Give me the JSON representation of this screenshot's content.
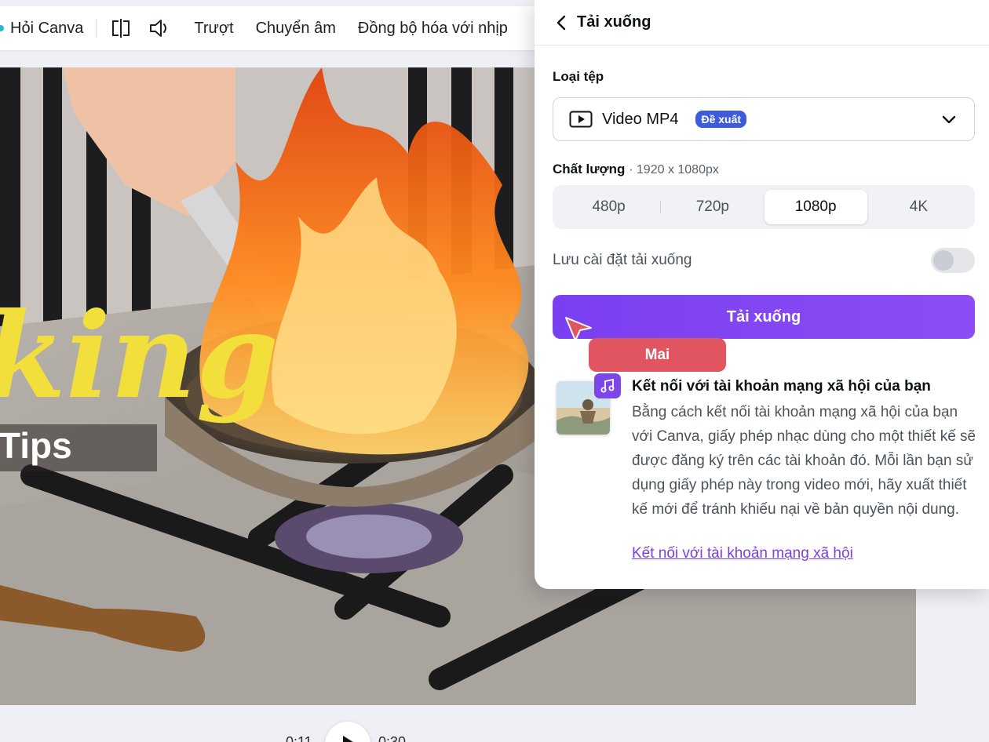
{
  "toolbar": {
    "ask_canva": "Hỏi Canva",
    "icons": [
      "flip-icon",
      "volume-icon"
    ],
    "transition": "Trượt",
    "transcribe": "Chuyển âm",
    "sync_beat": "Đồng bộ hóa với nhịp"
  },
  "canvas": {
    "overlay_word": "king",
    "overlay_tips": "Tips"
  },
  "playback": {
    "current_time": "0:11",
    "total_time": "0:30"
  },
  "panel": {
    "title": "Tải xuống",
    "file_type_label": "Loại tệp",
    "file_type_value": "Video MP4",
    "recommended_badge": "Đề xuất",
    "quality_label": "Chất lượng",
    "quality_resolution": "· 1920 x 1080px",
    "quality_options": [
      "480p",
      "720p",
      "1080p",
      "4K"
    ],
    "quality_selected": "1080p",
    "save_settings_label": "Lưu cài đặt tải xuống",
    "save_settings_on": false,
    "download_button": "Tải xuống",
    "connect": {
      "title": "Kết nối với tài khoản mạng xã hội của bạn",
      "body": "Bằng cách kết nối tài khoản mạng xã hội của bạn với Canva, giấy phép nhạc dùng cho một thiết kế sẽ được đăng ký trên các tài khoản đó. Mỗi lần bạn sử dụng giấy phép này trong video mới, hãy xuất thiết kế mới để tránh khiếu nại về bản quyền nội dung.",
      "link": "Kết nối với tài khoản mạng xã hội"
    }
  },
  "collaborator": {
    "name": "Mai",
    "color": "#e15561"
  },
  "colors": {
    "accent": "#7a3ff0",
    "badge": "#3f5bdd",
    "link": "#7c3fe0"
  }
}
